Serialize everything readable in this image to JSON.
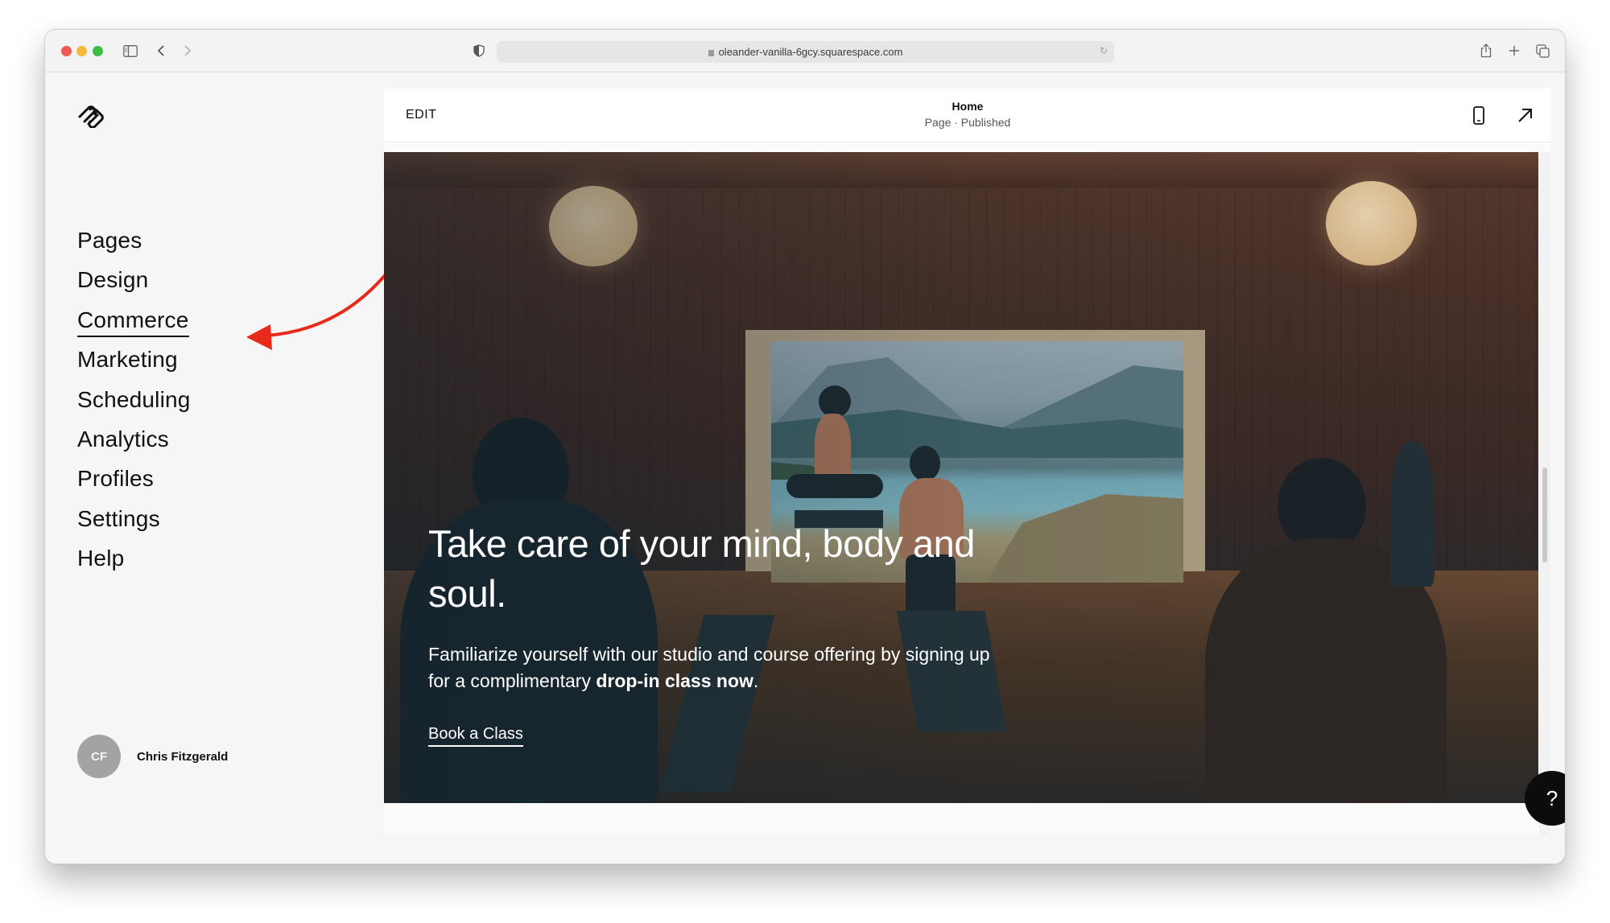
{
  "browser": {
    "url": "oleander-vanilla-6gcy.squarespace.com",
    "icons": {
      "sidebar_toggle": "sidebar-icon",
      "back": "chevron-left-icon",
      "forward": "chevron-right-icon",
      "privacy": "shield-icon",
      "lock": "lock-icon",
      "reload": "reload-icon",
      "share": "share-icon",
      "new_tab": "plus-icon",
      "tabs": "tab-overview-icon"
    }
  },
  "sidebar": {
    "logo": "squarespace-logo-icon",
    "items": [
      {
        "label": "Pages",
        "active": false
      },
      {
        "label": "Design",
        "active": false
      },
      {
        "label": "Commerce",
        "active": true
      },
      {
        "label": "Marketing",
        "active": false
      },
      {
        "label": "Scheduling",
        "active": false
      },
      {
        "label": "Analytics",
        "active": false
      },
      {
        "label": "Profiles",
        "active": false
      },
      {
        "label": "Settings",
        "active": false
      },
      {
        "label": "Help",
        "active": false
      }
    ],
    "user": {
      "initials": "CF",
      "name": "Chris Fitzgerald"
    }
  },
  "annotation": {
    "type": "arrow",
    "color": "#e8291c",
    "points_to": "Commerce"
  },
  "editor": {
    "edit_label": "EDIT",
    "page_title": "Home",
    "page_status": "Page · Published",
    "icons": {
      "mobile_preview": "mobile-phone-icon",
      "open_site": "arrow-up-right-icon"
    }
  },
  "hero": {
    "headline": "Take care of your mind, body and soul.",
    "body_prefix": "Familiarize yourself with our studio and course offering by signing up for a complimentary ",
    "body_bold": "drop-in class now",
    "body_suffix": ".",
    "cta_label": "Book a Class",
    "image_description": "Yoga studio with wooden walls, two pendant lamps and a large window overlooking a lake and mountains"
  },
  "help_button": {
    "label": "?"
  }
}
